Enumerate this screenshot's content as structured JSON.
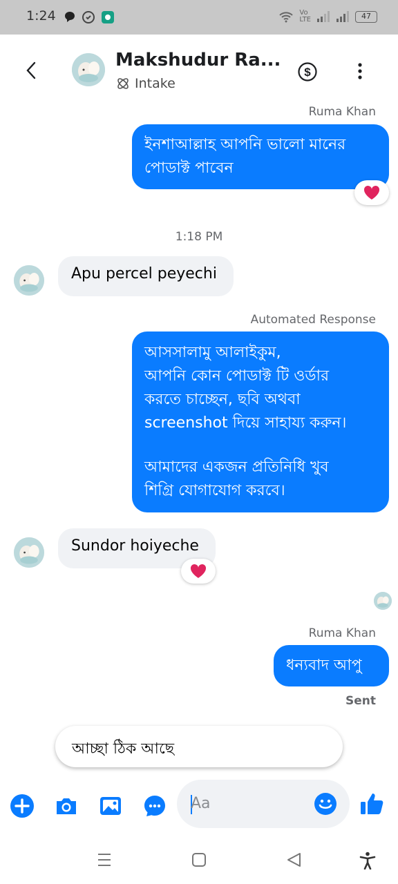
{
  "status_bar": {
    "time": "1:24",
    "battery": "47"
  },
  "header": {
    "name": "Makshudur Ra...",
    "subtitle": "Intake"
  },
  "messages": {
    "m1": {
      "sender": "Ruma Khan",
      "text_line1": "ইনশাআল্লাহ আপনি ভালো মানের",
      "text_line2": "পোডাক্ট পাবেন",
      "reaction": "heart"
    },
    "timestamp": "1:18 PM",
    "m2": {
      "text": "Apu percel peyechi"
    },
    "m3": {
      "sender": "Automated Response",
      "line1": "আসসালামু আলাইকুম,",
      "line2": "আপনি কোন পোডাক্ট টি ওর্ডার",
      "line3": "করতে চাচ্ছেন, ছবি অথবা",
      "line4": "screenshot দিয়ে সাহায্য করুন।",
      "line5": "আমাদের একজন প্রতিনিধি খুব",
      "line6": "শিগ্রি যোগাযোগ করবে।"
    },
    "m4": {
      "text": "Sundor hoiyeche",
      "reaction": "heart"
    },
    "m5": {
      "sender": "Ruma Khan",
      "text": "ধন্যবাদ আপু",
      "status": "Sent"
    }
  },
  "suggestion": {
    "text": "আচ্ছা ঠিক আছে"
  },
  "composer": {
    "placeholder": "Aa"
  },
  "colors": {
    "accent": "#0a7cff",
    "incoming_bubble": "#f0f2f5",
    "heart": "#e0245e"
  }
}
